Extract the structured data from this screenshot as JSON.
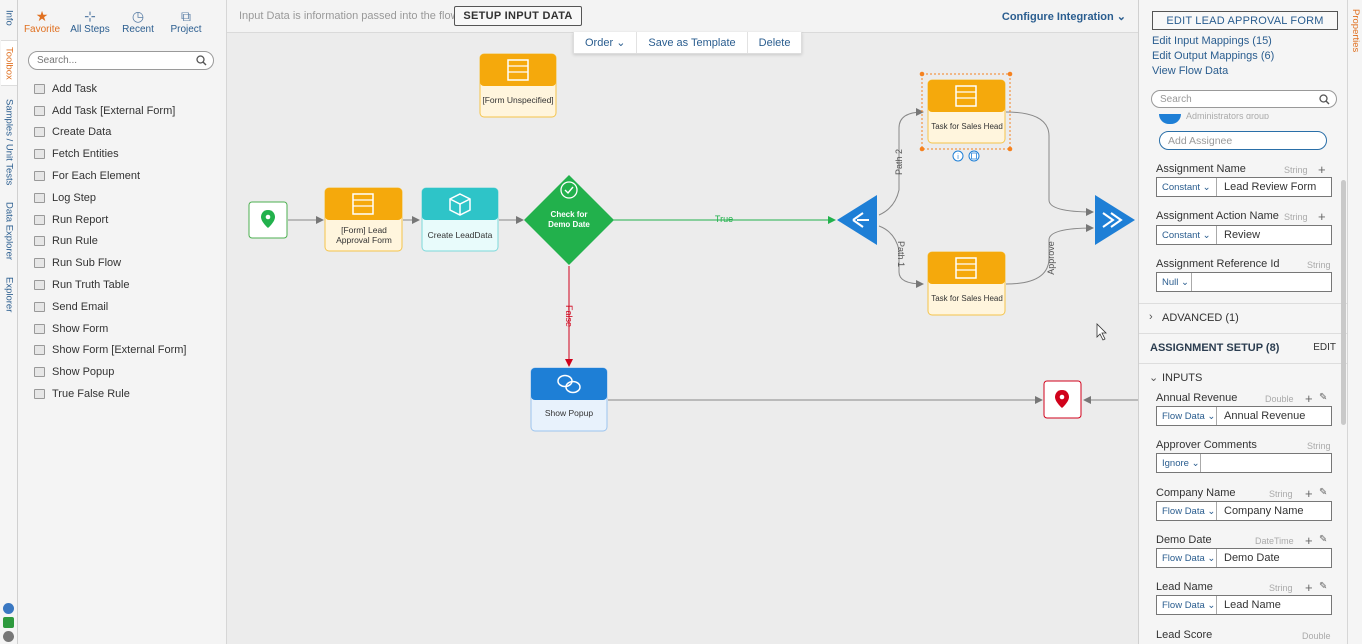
{
  "left_rail": {
    "tabs": [
      "Info",
      "Toolbox",
      "Samples / Unit Tests",
      "Data Explorer",
      "Explorer"
    ]
  },
  "toolbox": {
    "tabs": [
      {
        "label": "Favorite",
        "icon": "star-icon"
      },
      {
        "label": "All Steps",
        "icon": "all-steps-icon"
      },
      {
        "label": "Recent",
        "icon": "clock-icon"
      },
      {
        "label": "Project",
        "icon": "project-icon"
      }
    ],
    "search_placeholder": "Search...",
    "items": [
      "Add Task",
      "Add Task [External Form]",
      "Create Data",
      "Fetch Entities",
      "For Each Element",
      "Log Step",
      "Run Report",
      "Run Rule",
      "Run Sub Flow",
      "Run Truth Table",
      "Send Email",
      "Show Form",
      "Show Form [External Form]",
      "Show Popup",
      "True False Rule"
    ]
  },
  "canvas": {
    "info_text": "Input Data is information passed into the flow",
    "setup_button": "SETUP INPUT DATA",
    "configure": "Configure Integration",
    "actions": [
      "Order",
      "Save as Template",
      "Delete"
    ],
    "nodes": {
      "form_unspecified": "[Form Unspecified]",
      "lead_form_1": "[Form] Lead",
      "lead_form_2": "Approval Form",
      "create_leaddata": "Create LeadData",
      "check_1": "Check for",
      "check_2": "Demo Date",
      "task_top": "Task for Sales Head",
      "task_bottom": "Task for Sales Head",
      "show_popup": "Show Popup"
    },
    "edges": {
      "true_label": "True",
      "false_label": "False",
      "path2": "Path 2",
      "path1": "Path 1",
      "approve": "Approve"
    },
    "colors": {
      "form_orange": "#f5a90c",
      "teal": "#2ec4c8",
      "green": "#22b14c",
      "blue": "#1e7fd6",
      "red": "#d0021b"
    }
  },
  "properties": {
    "rail_label": "Properties",
    "edit_button": "EDIT LEAD APPROVAL FORM",
    "links": [
      "Edit Input Mappings (15)",
      "Edit Output Mappings (6)",
      "View Flow Data"
    ],
    "search_placeholder": "Search",
    "partial_text": "Administrators group",
    "add_assignee": "Add Assignee",
    "assignment_name": {
      "label": "Assignment Name",
      "type": "String",
      "mode": "Constant",
      "value": "Lead Review Form"
    },
    "assignment_action": {
      "label": "Assignment Action Name",
      "type": "String",
      "mode": "Constant",
      "value": "Review"
    },
    "assignment_ref": {
      "label": "Assignment Reference Id",
      "type": "String",
      "mode": "Null",
      "value": ""
    },
    "advanced": "ADVANCED (1)",
    "setup": {
      "label": "ASSIGNMENT SETUP (8)",
      "edit": "EDIT"
    },
    "inputs_label": "INPUTS",
    "inputs": [
      {
        "label": "Annual Revenue",
        "type": "Double",
        "mode": "Flow Data",
        "value": "Annual Revenue"
      },
      {
        "label": "Approver Comments",
        "type": "String",
        "mode": "Ignore",
        "value": ""
      },
      {
        "label": "Company Name",
        "type": "String",
        "mode": "Flow Data",
        "value": "Company Name"
      },
      {
        "label": "Demo Date",
        "type": "DateTime",
        "mode": "Flow Data",
        "value": "Demo Date"
      },
      {
        "label": "Lead Name",
        "type": "String",
        "mode": "Flow Data",
        "value": "Lead Name"
      }
    ],
    "last_label": "Lead Score",
    "last_type": "Double"
  }
}
